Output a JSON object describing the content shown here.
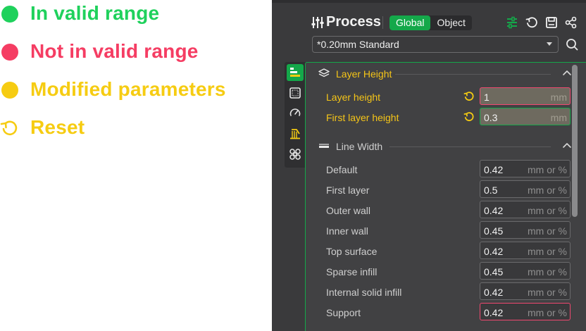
{
  "colors": {
    "valid_green": "#1fd15c",
    "invalid_red": "#f53d63",
    "modified_yellow": "#f6cc12",
    "accent": "#14a84a"
  },
  "legend": {
    "items": [
      {
        "label": "In valid range",
        "kind": "dot",
        "color": "#1fd15c",
        "icon": "green-dot-icon"
      },
      {
        "label": "Not in valid range",
        "kind": "dot",
        "color": "#f53d63",
        "icon": "red-dot-icon"
      },
      {
        "label": "Modified parameters",
        "kind": "dot",
        "color": "#f6cc12",
        "icon": "yellow-dot-icon"
      },
      {
        "label": "Reset",
        "kind": "reset",
        "color": "#f6cc12",
        "icon": "reset-icon"
      }
    ]
  },
  "panel": {
    "title": "Process",
    "tabs": [
      {
        "label": "Global",
        "active": true
      },
      {
        "label": "Object",
        "active": false
      }
    ],
    "header_icons": [
      "compare-icon",
      "reset-all-icon",
      "save-icon",
      "share-icon"
    ],
    "preset": {
      "value": "*0.20mm Standard",
      "icon": "dropdown-arrow-icon"
    },
    "search_icon": "search-icon",
    "side_tabs": [
      {
        "icon": "quality-icon",
        "active": true
      },
      {
        "icon": "strength-icon",
        "active": false
      },
      {
        "icon": "speed-icon",
        "active": false
      },
      {
        "icon": "support-icon",
        "active": false
      },
      {
        "icon": "others-icon",
        "active": false
      }
    ],
    "sections": [
      {
        "title": "Layer Height",
        "icon": "layer-height-icon",
        "rows": [
          {
            "label": "Layer height",
            "value": "1",
            "unit": "mm",
            "modified": true,
            "state": "invalid"
          },
          {
            "label": "First layer height",
            "value": "0.3",
            "unit": "mm",
            "modified": true,
            "state": "valid"
          }
        ]
      },
      {
        "title": "Line Width",
        "icon": "line-width-icon",
        "rows": [
          {
            "label": "Default",
            "value": "0.42",
            "unit": "mm or %",
            "modified": false,
            "state": "normal"
          },
          {
            "label": "First layer",
            "value": "0.5",
            "unit": "mm or %",
            "modified": false,
            "state": "normal"
          },
          {
            "label": "Outer wall",
            "value": "0.42",
            "unit": "mm or %",
            "modified": false,
            "state": "normal"
          },
          {
            "label": "Inner wall",
            "value": "0.45",
            "unit": "mm or %",
            "modified": false,
            "state": "normal"
          },
          {
            "label": "Top surface",
            "value": "0.42",
            "unit": "mm or %",
            "modified": false,
            "state": "normal"
          },
          {
            "label": "Sparse infill",
            "value": "0.45",
            "unit": "mm or %",
            "modified": false,
            "state": "normal"
          },
          {
            "label": "Internal solid infill",
            "value": "0.42",
            "unit": "mm or %",
            "modified": false,
            "state": "normal"
          },
          {
            "label": "Support",
            "value": "0.42",
            "unit": "mm or %",
            "modified": false,
            "state": "invalid"
          }
        ]
      }
    ]
  }
}
